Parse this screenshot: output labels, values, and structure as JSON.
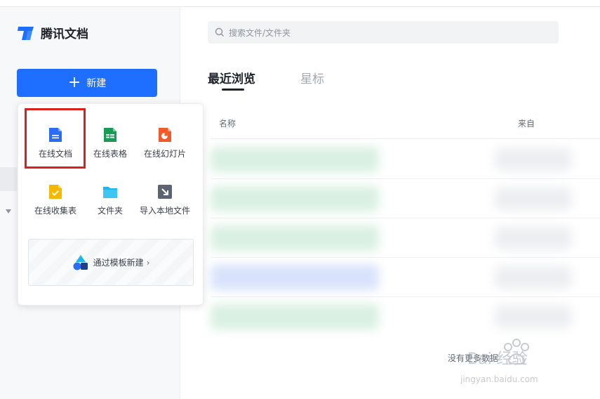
{
  "app": {
    "name": "腾讯文档",
    "accent": "#1e6fff"
  },
  "sidebar": {
    "new_button": "新建"
  },
  "new_menu": {
    "items": [
      {
        "label": "在线文档",
        "icon": "doc-icon",
        "color": "#2b6cf6"
      },
      {
        "label": "在线表格",
        "icon": "sheet-icon",
        "color": "#1a9b55"
      },
      {
        "label": "在线幻灯片",
        "icon": "slides-icon",
        "color": "#f25a2a"
      },
      {
        "label": "在线收集表",
        "icon": "form-icon",
        "color": "#f5b700"
      },
      {
        "label": "文件夹",
        "icon": "folder-icon",
        "color": "#1eb6ee"
      },
      {
        "label": "导入本地文件",
        "icon": "import-icon",
        "color": "#5b6470"
      }
    ],
    "template_link": "通过模板新建",
    "template_chevron": "›"
  },
  "search": {
    "placeholder": "搜索文件/文件夹"
  },
  "tabs": {
    "recent": "最近浏览",
    "starred": "星标"
  },
  "table": {
    "columns": {
      "name": "名称",
      "from": "来自"
    },
    "row_tints": [
      "#d9f0e2",
      "#d9f0e2",
      "#d9f0e2",
      "#d8e2fb",
      "#d9f0e2"
    ]
  },
  "footer": {
    "no_more": "没有更多数据"
  },
  "watermark": {
    "brand": "Bai 经验",
    "url": "jingyan.baidu.com"
  }
}
